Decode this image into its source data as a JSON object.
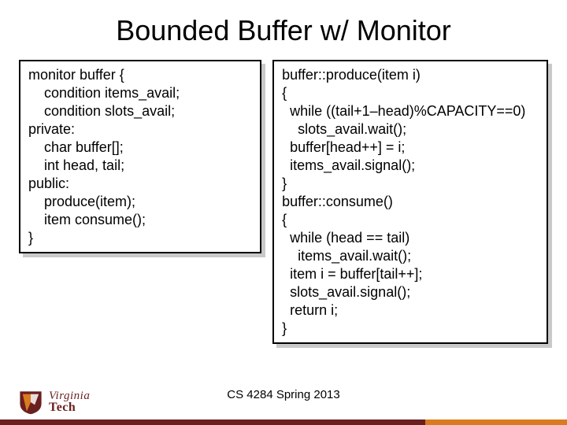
{
  "title": "Bounded Buffer w/ Monitor",
  "code_left": "monitor buffer {\n    condition items_avail;\n    condition slots_avail;\nprivate:\n    char buffer[];\n    int head, tail;\npublic:\n    produce(item);\n    item consume();\n}",
  "code_right": "buffer::produce(item i)\n{\n  while ((tail+1–head)%CAPACITY==0)\n    slots_avail.wait();\n  buffer[head++] = i;\n  items_avail.signal();\n}\nbuffer::consume()\n{\n  while (head == tail)\n    items_avail.wait();\n  item i = buffer[tail++];\n  slots_avail.signal();\n  return i;\n}",
  "footer": "CS 4284 Spring 2013",
  "logo": {
    "line1": "Virginia",
    "line2": "Tech"
  },
  "colors": {
    "maroon": "#6b1f1f",
    "orange": "#d97b1e"
  }
}
